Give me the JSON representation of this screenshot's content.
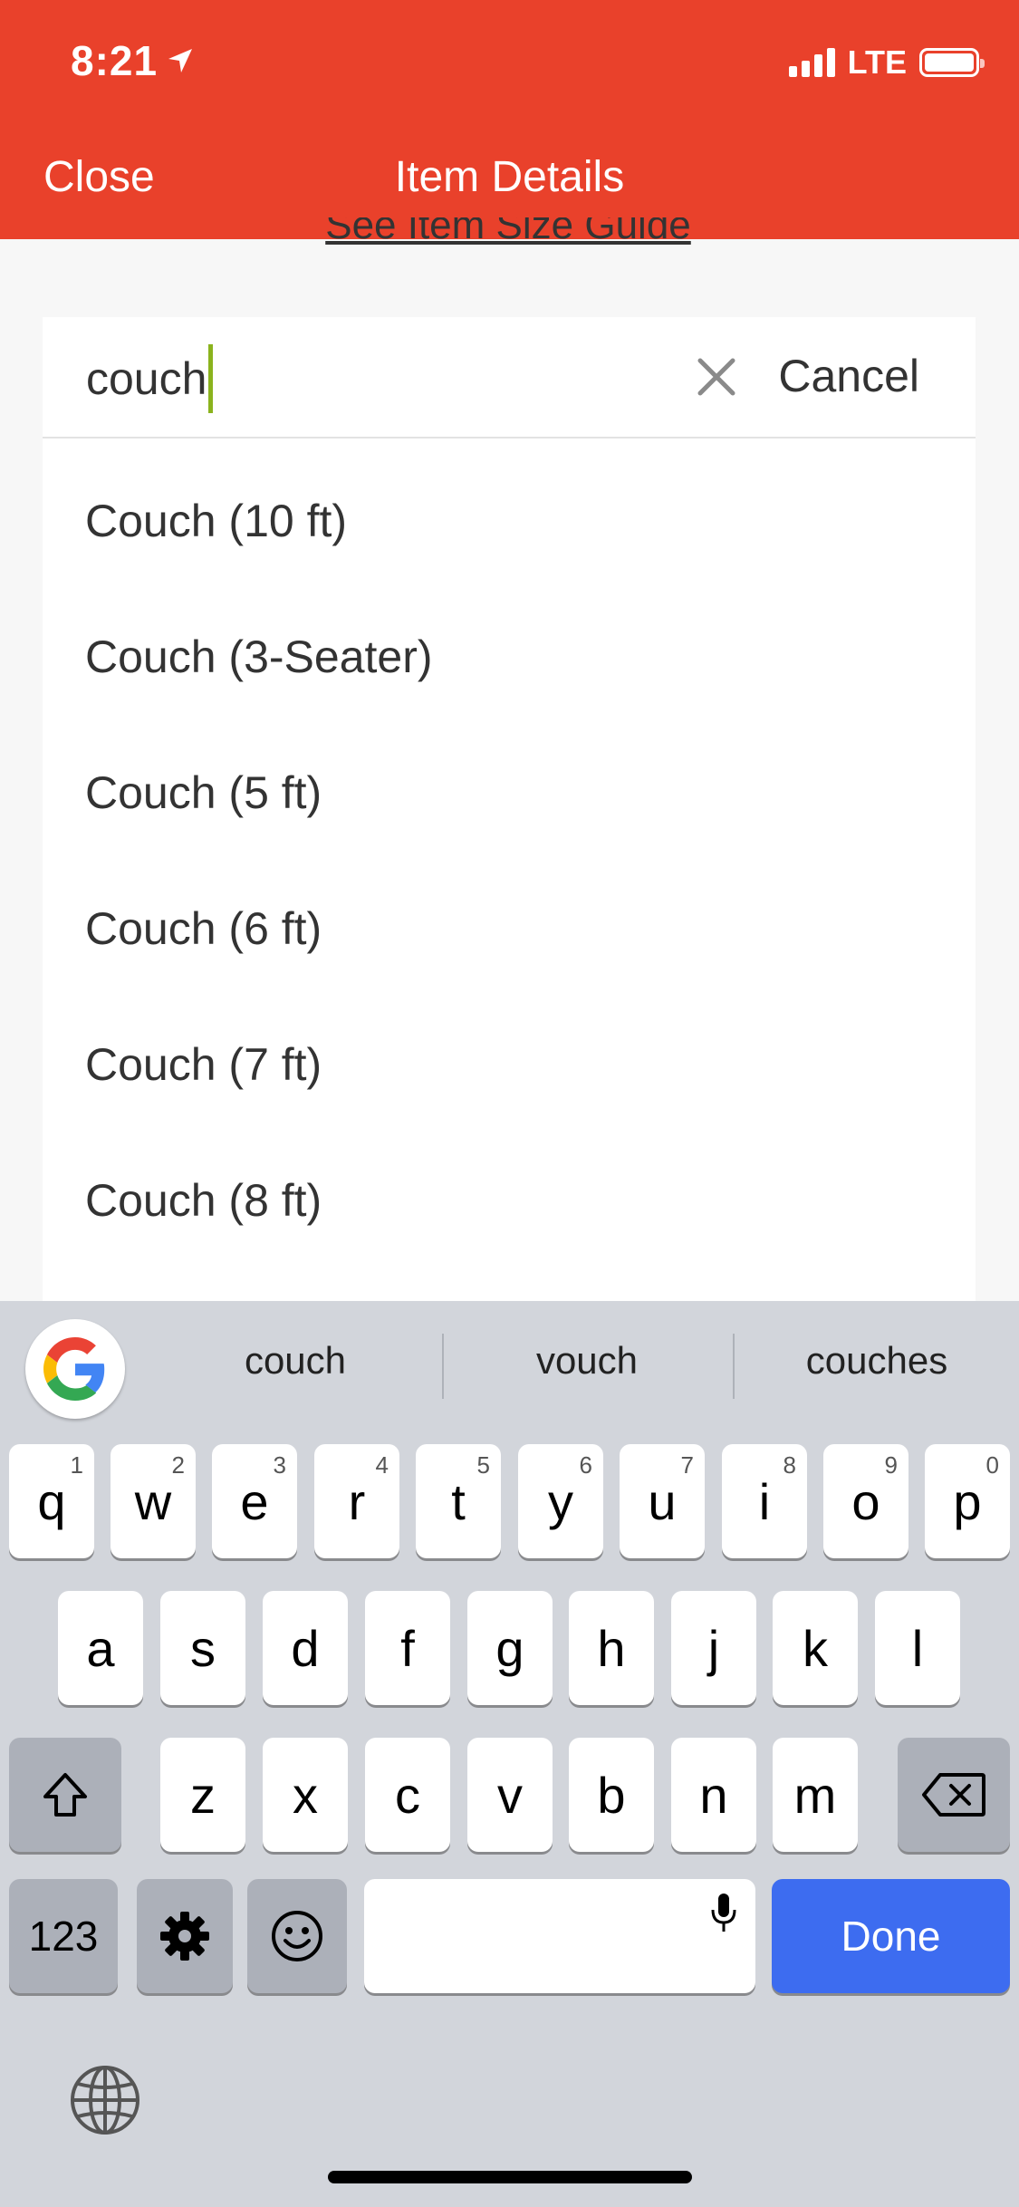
{
  "status_bar": {
    "time": "8:21",
    "network": "LTE"
  },
  "header": {
    "close_label": "Close",
    "title": "Item Details"
  },
  "underlying_link": "See Item Size Guide",
  "search": {
    "value": "couch",
    "cancel_label": "Cancel"
  },
  "results": [
    "Couch (10 ft)",
    "Couch (3-Seater)",
    "Couch (5 ft)",
    "Couch (6 ft)",
    "Couch (7 ft)",
    "Couch (8 ft)"
  ],
  "keyboard": {
    "suggestions": [
      "couch",
      "vouch",
      "couches"
    ],
    "row1": [
      {
        "k": "q",
        "n": "1"
      },
      {
        "k": "w",
        "n": "2"
      },
      {
        "k": "e",
        "n": "3"
      },
      {
        "k": "r",
        "n": "4"
      },
      {
        "k": "t",
        "n": "5"
      },
      {
        "k": "y",
        "n": "6"
      },
      {
        "k": "u",
        "n": "7"
      },
      {
        "k": "i",
        "n": "8"
      },
      {
        "k": "o",
        "n": "9"
      },
      {
        "k": "p",
        "n": "0"
      }
    ],
    "row2": [
      "a",
      "s",
      "d",
      "f",
      "g",
      "h",
      "j",
      "k",
      "l"
    ],
    "row3": [
      "z",
      "x",
      "c",
      "v",
      "b",
      "n",
      "m"
    ],
    "numbers_label": "123",
    "done_label": "Done"
  },
  "colors": {
    "header": "#e9412b",
    "caret": "#8bb31d",
    "done": "#3d6cf0"
  }
}
